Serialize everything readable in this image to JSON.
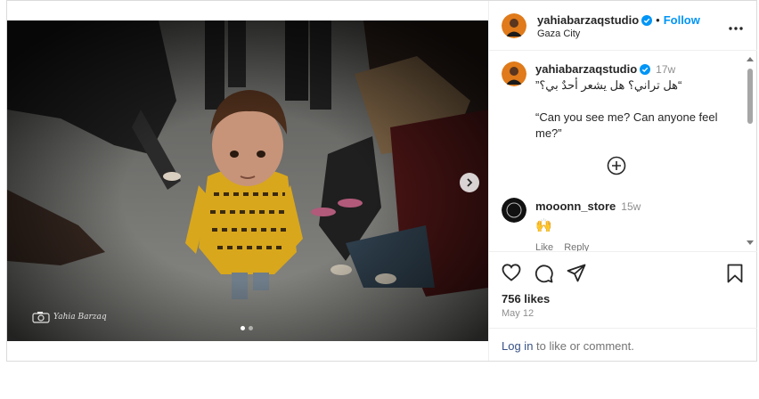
{
  "post": {
    "author": {
      "username": "yahiabarzaqstudio",
      "location": "Gaza City",
      "follow_label": "Follow",
      "separator": "•"
    },
    "caption": {
      "username": "yahiabarzaqstudio",
      "time": "17w",
      "line_arabic": "“هل تراني؟ هل يشعر أحدٌ بي؟”",
      "line_english": "“Can you see me? Can anyone feel me?”"
    },
    "comments": [
      {
        "username": "mooonn_store",
        "time": "15w",
        "text": "🙌",
        "like_label": "Like",
        "reply_label": "Reply"
      }
    ],
    "likes_text": "756 likes",
    "date_text": "May 12",
    "login": {
      "link_text": "Log in",
      "rest_text": " to like or comment."
    },
    "media": {
      "watermark_text": "Yahia Barzaq",
      "slide_count": 2,
      "active_slide": 1
    }
  },
  "colors": {
    "link_blue": "#0095f6",
    "login_blue": "#385185",
    "verified_blue": "#0095f6",
    "muted": "#8e8e8e",
    "border": "#dbdbdb"
  },
  "icons": [
    "verified-icon",
    "more-options-icon",
    "add-comment-icon",
    "heart-icon",
    "comment-icon",
    "share-icon",
    "save-icon",
    "chevron-right-icon"
  ]
}
